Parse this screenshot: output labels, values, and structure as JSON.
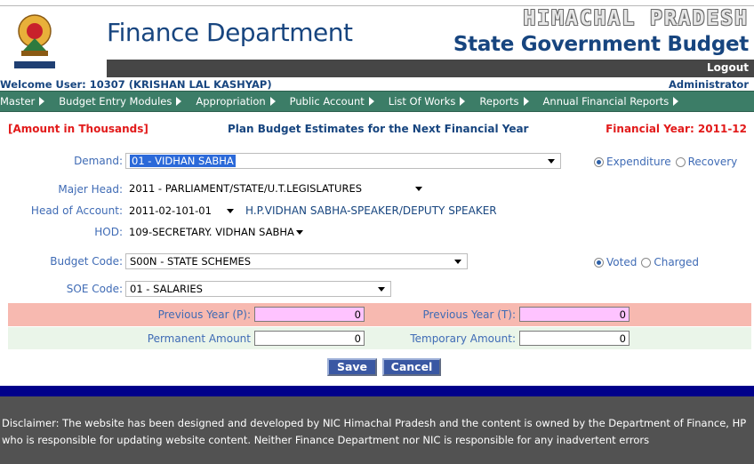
{
  "header": {
    "dept_title": "Finance Department",
    "state_name": "HIMACHAL PRADESH",
    "budget_title": "State Government Budget",
    "logout_label": "Logout"
  },
  "user": {
    "welcome": "Welcome User: 10307 (KRISHAN LAL KASHYAP)",
    "role": "Administrator"
  },
  "menu": [
    {
      "label": "Master"
    },
    {
      "label": "Budget Entry Modules"
    },
    {
      "label": "Appropriation"
    },
    {
      "label": "Public Account"
    },
    {
      "label": "List Of Works"
    },
    {
      "label": "Reports"
    },
    {
      "label": "Annual Financial Reports"
    }
  ],
  "info": {
    "amount_note": "[Amount in Thousands]",
    "form_title": "Plan Budget Estimates for the Next Financial Year",
    "financial_year": "Financial Year: 2011-12"
  },
  "form": {
    "demand": {
      "label": "Demand:",
      "value": "01 - VIDHAN SABHA"
    },
    "demand_type": {
      "options": [
        "Expenditure",
        "Recovery"
      ],
      "selected": "Expenditure"
    },
    "major_head": {
      "label": "Majer Head:",
      "value": "2011 - PARLIAMENT/STATE/U.T.LEGISLATURES"
    },
    "head_of_account": {
      "label": "Head of Account:",
      "value": "2011-02-101-01",
      "description": "H.P.VIDHAN SABHA-SPEAKER/DEPUTY SPEAKER"
    },
    "hod": {
      "label": "HOD:",
      "value": "109-SECRETARY. VIDHAN SABHA"
    },
    "budget_code": {
      "label": "Budget Code:",
      "value": "S00N - STATE SCHEMES"
    },
    "vote_type": {
      "options": [
        "Voted",
        "Charged"
      ],
      "selected": "Voted"
    },
    "soe_code": {
      "label": "SOE Code:",
      "value": "01 - SALARIES"
    },
    "previous_year_p": {
      "label": "Previous Year (P):",
      "value": "0"
    },
    "previous_year_t": {
      "label": "Previous Year (T):",
      "value": "0"
    },
    "permanent_amount": {
      "label": "Permanent Amount",
      "value": "0"
    },
    "temporary_amount": {
      "label": "Temporary Amount:",
      "value": "0"
    },
    "save_label": "Save",
    "cancel_label": "Cancel"
  },
  "footer": {
    "disclaimer": "Disclaimer: The website has been designed and developed by NIC Himachal Pradesh and the content is owned by the Department of Finance, HP who is responsible for updating website content. Neither Finance Department nor NIC is responsible for any inadvertent errors"
  }
}
